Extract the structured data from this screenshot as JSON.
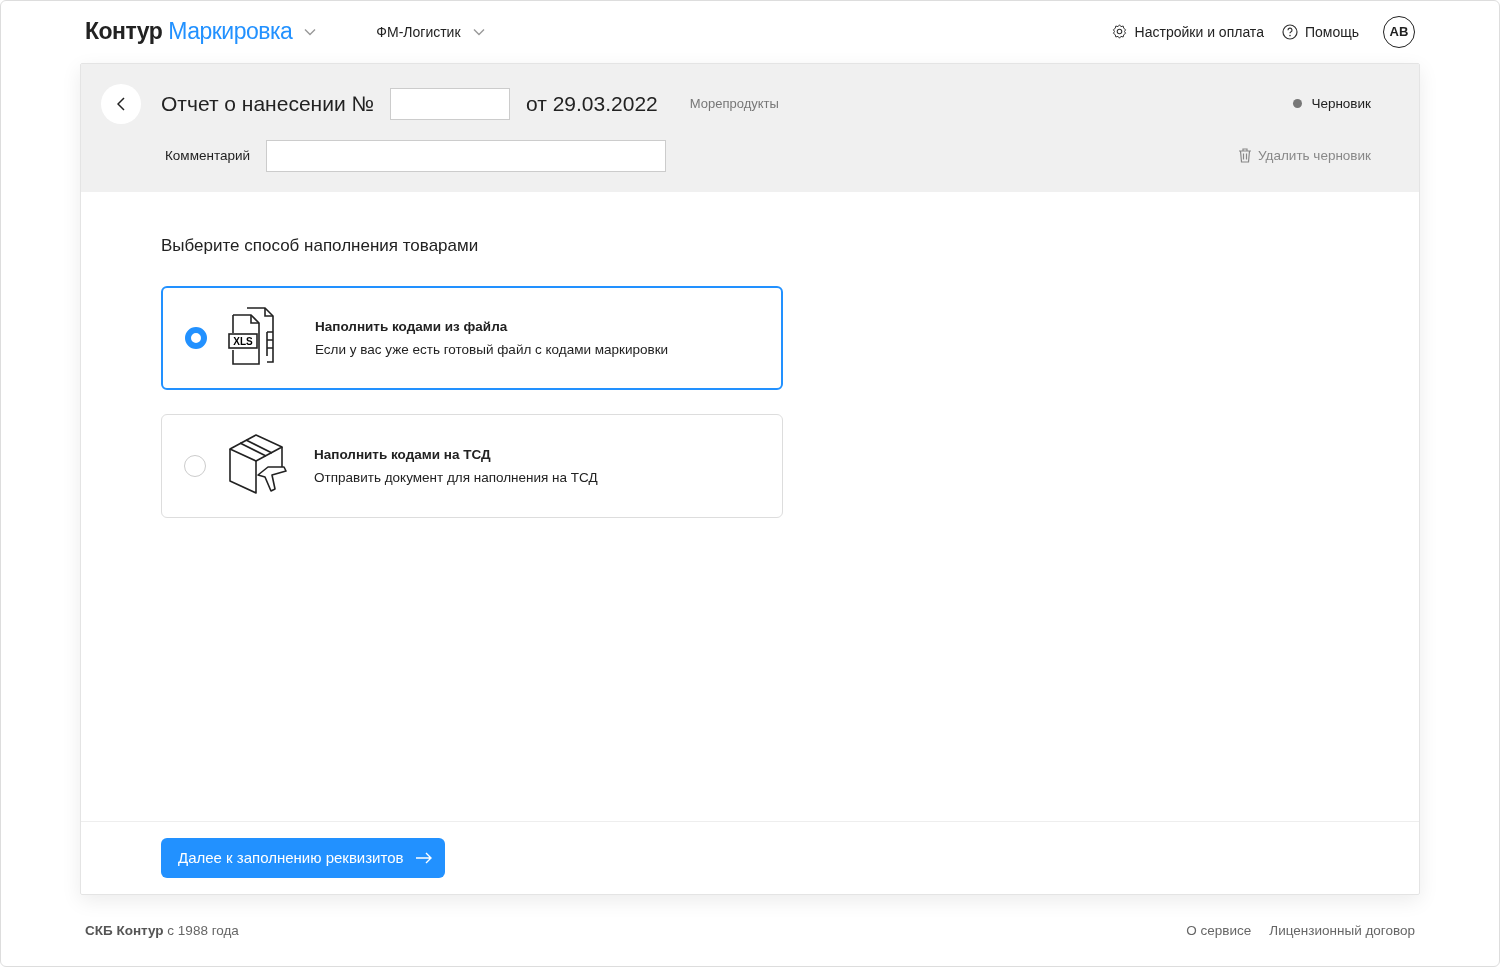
{
  "header": {
    "logo_brand": "Контур",
    "logo_product": "Маркировка",
    "organization": "ФМ-Логистик",
    "settings": "Настройки и оплата",
    "help": "Помощь",
    "avatar": "AB"
  },
  "document": {
    "title": "Отчет о нанесении №",
    "date": "от 29.03.2022",
    "category": "Морепродукты",
    "status": {
      "label": "Черновик",
      "color": "#777777"
    },
    "comment_label": "Комментарий",
    "delete": "Удалить черновик"
  },
  "section_title": "Выберите способ наполнения товарами",
  "options": [
    {
      "kind": "file",
      "title": "Наполнить кодами из файла",
      "description": "Если у вас уже есть готовый файл с кодами маркировки",
      "icon_label": "XLS",
      "selected": true
    },
    {
      "kind": "scanner",
      "title": "Наполнить кодами на ТСД",
      "description": "Отправить документ для наполнения на ТСД",
      "selected": false
    }
  ],
  "next_button": "Далее к заполнению реквизитов",
  "footer": {
    "copyright": "**СКБ Контур** с 1988 года",
    "links": [
      "О сервисе",
      "Лицензионный договор"
    ]
  }
}
